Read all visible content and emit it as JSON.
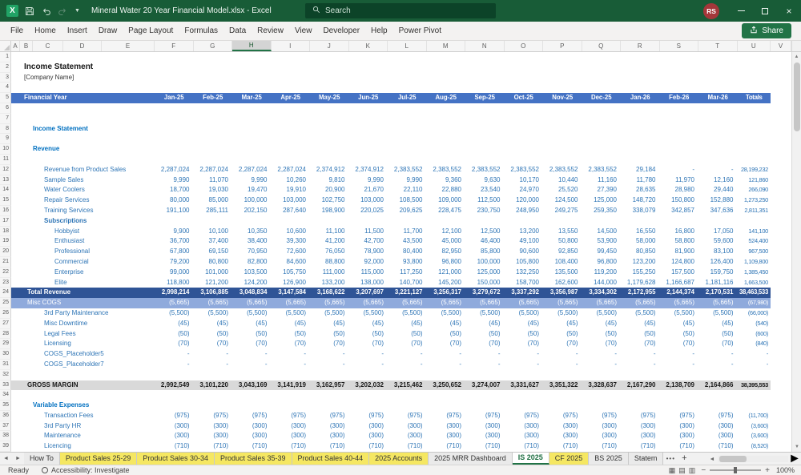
{
  "title_bar": {
    "app_title": "Mineral Water 20 Year Financial Model.xlsx - Excel",
    "search_placeholder": "Search",
    "user_initials": "RS"
  },
  "ribbon": {
    "tabs": [
      "File",
      "Home",
      "Insert",
      "Draw",
      "Page Layout",
      "Formulas",
      "Data",
      "Review",
      "View",
      "Developer",
      "Help",
      "Power Pivot"
    ],
    "share_label": "Share"
  },
  "grid_header": {
    "columns": [
      "A",
      "B",
      "C",
      "D",
      "E",
      "F",
      "G",
      "H",
      "I",
      "J",
      "K",
      "L",
      "M",
      "N",
      "O",
      "P",
      "Q",
      "R",
      "S",
      "T",
      "U",
      "V"
    ],
    "active_column": "H"
  },
  "sheet": {
    "header": {
      "label": "Financial Year",
      "months": [
        "Jan-25",
        "Feb-25",
        "Mar-25",
        "Apr-25",
        "May-25",
        "Jun-25",
        "Jul-25",
        "Aug-25",
        "Sep-25",
        "Oct-25",
        "Nov-25",
        "Dec-25",
        "Jan-26",
        "Feb-26",
        "Mar-26"
      ],
      "totals": "Totals"
    },
    "rows": [
      {
        "n": 1
      },
      {
        "n": 2,
        "label": "Income Statement",
        "cls": "title"
      },
      {
        "n": 3,
        "label": "[Company Name]",
        "cls": "subtitle"
      },
      {
        "n": 4
      },
      {
        "n": 5,
        "type": "header"
      },
      {
        "n": 6
      },
      {
        "n": 7
      },
      {
        "n": 8,
        "label": "Income Statement",
        "cls": "section"
      },
      {
        "n": 9
      },
      {
        "n": 10,
        "label": "Revenue",
        "cls": "section"
      },
      {
        "n": 11
      },
      {
        "n": 12,
        "label": "Revenue from Product Sales",
        "cls": "item",
        "v": [
          "2,287,024",
          "2,287,024",
          "2,287,024",
          "2,287,024",
          "2,374,912",
          "2,374,912",
          "2,383,552",
          "2,383,552",
          "2,383,552",
          "2,383,552",
          "2,383,552",
          "2,383,552",
          "29,184",
          "-",
          "-"
        ],
        "t": "28,199,232"
      },
      {
        "n": 13,
        "label": "Sample Sales",
        "cls": "item",
        "v": [
          "9,990",
          "11,070",
          "9,990",
          "10,260",
          "9,810",
          "9,990",
          "9,990",
          "9,360",
          "9,630",
          "10,170",
          "10,440",
          "11,160",
          "11,780",
          "11,970",
          "12,160"
        ],
        "t": "121,860"
      },
      {
        "n": 14,
        "label": "Water Coolers",
        "cls": "item",
        "v": [
          "18,700",
          "19,030",
          "19,470",
          "19,910",
          "20,900",
          "21,670",
          "22,110",
          "22,880",
          "23,540",
          "24,970",
          "25,520",
          "27,390",
          "28,635",
          "28,980",
          "29,440"
        ],
        "t": "266,090"
      },
      {
        "n": 15,
        "label": "Repair Services",
        "cls": "item",
        "v": [
          "80,000",
          "85,000",
          "100,000",
          "103,000",
          "102,750",
          "103,000",
          "108,500",
          "109,000",
          "112,500",
          "120,000",
          "124,500",
          "125,000",
          "148,720",
          "150,800",
          "152,880"
        ],
        "t": "1,273,250"
      },
      {
        "n": 16,
        "label": "Training Services",
        "cls": "item",
        "v": [
          "191,100",
          "285,111",
          "202,150",
          "287,640",
          "198,900",
          "220,025",
          "209,625",
          "228,475",
          "230,750",
          "248,950",
          "249,275",
          "259,350",
          "338,079",
          "342,857",
          "347,636"
        ],
        "t": "2,811,351"
      },
      {
        "n": 17,
        "label": "Subscriptions",
        "cls": "group"
      },
      {
        "n": 18,
        "label": "Hobbyist",
        "cls": "subitem",
        "v": [
          "9,900",
          "10,100",
          "10,350",
          "10,600",
          "11,100",
          "11,500",
          "11,700",
          "12,100",
          "12,500",
          "13,200",
          "13,550",
          "14,500",
          "16,550",
          "16,800",
          "17,050"
        ],
        "t": "141,100"
      },
      {
        "n": 19,
        "label": "Enthusiast",
        "cls": "subitem",
        "v": [
          "36,700",
          "37,400",
          "38,400",
          "39,300",
          "41,200",
          "42,700",
          "43,500",
          "45,000",
          "46,400",
          "49,100",
          "50,800",
          "53,900",
          "58,000",
          "58,800",
          "59,600"
        ],
        "t": "524,400"
      },
      {
        "n": 20,
        "label": "Professional",
        "cls": "subitem",
        "v": [
          "67,800",
          "69,150",
          "70,950",
          "72,600",
          "76,050",
          "78,900",
          "80,400",
          "82,950",
          "85,800",
          "90,600",
          "92,850",
          "99,450",
          "80,850",
          "81,900",
          "83,100"
        ],
        "t": "967,500"
      },
      {
        "n": 21,
        "label": "Commercial",
        "cls": "subitem",
        "v": [
          "79,200",
          "80,800",
          "82,800",
          "84,600",
          "88,800",
          "92,000",
          "93,800",
          "96,800",
          "100,000",
          "105,800",
          "108,400",
          "96,800",
          "123,200",
          "124,800",
          "126,400"
        ],
        "t": "1,109,800"
      },
      {
        "n": 22,
        "label": "Enterprise",
        "cls": "subitem",
        "v": [
          "99,000",
          "101,000",
          "103,500",
          "105,750",
          "111,000",
          "115,000",
          "117,250",
          "121,000",
          "125,000",
          "132,250",
          "135,500",
          "119,200",
          "155,250",
          "157,500",
          "159,750"
        ],
        "t": "1,385,450"
      },
      {
        "n": 23,
        "label": "Elite",
        "cls": "subitem",
        "v": [
          "118,800",
          "121,200",
          "124,200",
          "126,900",
          "133,200",
          "138,000",
          "140,700",
          "145,200",
          "150,000",
          "158,700",
          "162,600",
          "144,000",
          "1,179,628",
          "1,166,687",
          "1,181,116"
        ],
        "t": "1,663,500"
      },
      {
        "n": 24,
        "label": "Total Revenue",
        "cls": "totaldark",
        "v": [
          "2,998,214",
          "3,106,885",
          "3,048,834",
          "3,147,584",
          "3,168,622",
          "3,207,697",
          "3,221,127",
          "3,256,317",
          "3,279,672",
          "3,337,292",
          "3,356,987",
          "3,334,302",
          "2,172,955",
          "2,144,374",
          "2,170,531"
        ],
        "t": "38,463,533"
      },
      {
        "n": 25,
        "label": "Misc COGS",
        "cls": "totalmid",
        "fill": "(5,665)",
        "t": "(67,980)"
      },
      {
        "n": 26,
        "label": "3rd Party Maintenance",
        "cls": "item",
        "fill": "(5,500)",
        "t": "(66,000)"
      },
      {
        "n": 27,
        "label": "Misc Downtime",
        "cls": "item",
        "fill": "(45)",
        "t": "(540)"
      },
      {
        "n": 28,
        "label": "Legal Fees",
        "cls": "item",
        "fill": "(50)",
        "t": "(600)"
      },
      {
        "n": 29,
        "label": "Licensing",
        "cls": "item",
        "fill": "(70)",
        "t": "(840)"
      },
      {
        "n": 30,
        "label": "COGS_Placeholder5",
        "cls": "item",
        "fill": "-",
        "t": "-"
      },
      {
        "n": 31,
        "label": "COGS_Placeholder7",
        "cls": "item",
        "fill": "-",
        "t": "-"
      },
      {
        "n": 32
      },
      {
        "n": 33,
        "label": "GROSS MARGIN",
        "cls": "gross",
        "v": [
          "2,992,549",
          "3,101,220",
          "3,043,169",
          "3,141,919",
          "3,162,957",
          "3,202,032",
          "3,215,462",
          "3,250,652",
          "3,274,007",
          "3,331,627",
          "3,351,322",
          "3,328,637",
          "2,167,290",
          "2,138,709",
          "2,164,866"
        ],
        "t": "38,395,553"
      },
      {
        "n": 34
      },
      {
        "n": 35,
        "label": "Variable Expenses",
        "cls": "section"
      },
      {
        "n": 36,
        "label": "Transaction Fees",
        "cls": "item",
        "fill": "(975)",
        "t": "(11,700)"
      },
      {
        "n": 37,
        "label": "3rd Party HR",
        "cls": "item",
        "fill": "(300)",
        "t": "(3,600)"
      },
      {
        "n": 38,
        "label": "Maintenance",
        "cls": "item",
        "fill": "(300)",
        "t": "(3,600)"
      },
      {
        "n": 39,
        "label": "Licencing",
        "cls": "item",
        "fill": "(710)",
        "t": "(8,520)"
      }
    ]
  },
  "sheet_tabs": {
    "tabs": [
      {
        "label": "How To",
        "style": "plain"
      },
      {
        "label": "Product Sales 25-29",
        "style": "yellow"
      },
      {
        "label": "Product Sales 30-34",
        "style": "yellow"
      },
      {
        "label": "Product Sales 35-39",
        "style": "yellow"
      },
      {
        "label": "Product Sales 40-44",
        "style": "yellow"
      },
      {
        "label": "2025 Accounts",
        "style": "yellow"
      },
      {
        "label": "2025 MRR Dashboard",
        "style": "plain"
      },
      {
        "label": "IS 2025",
        "style": "active"
      },
      {
        "label": "CF 2025",
        "style": "yellow"
      },
      {
        "label": "BS 2025",
        "style": "plain"
      },
      {
        "label": "Statem",
        "style": "plain"
      }
    ],
    "more": "•••",
    "add": "+"
  },
  "status_bar": {
    "ready": "Ready",
    "accessibility": "Accessibility: Investigate",
    "zoom_minus": "−",
    "zoom_plus": "+",
    "zoom_level": "100%"
  }
}
